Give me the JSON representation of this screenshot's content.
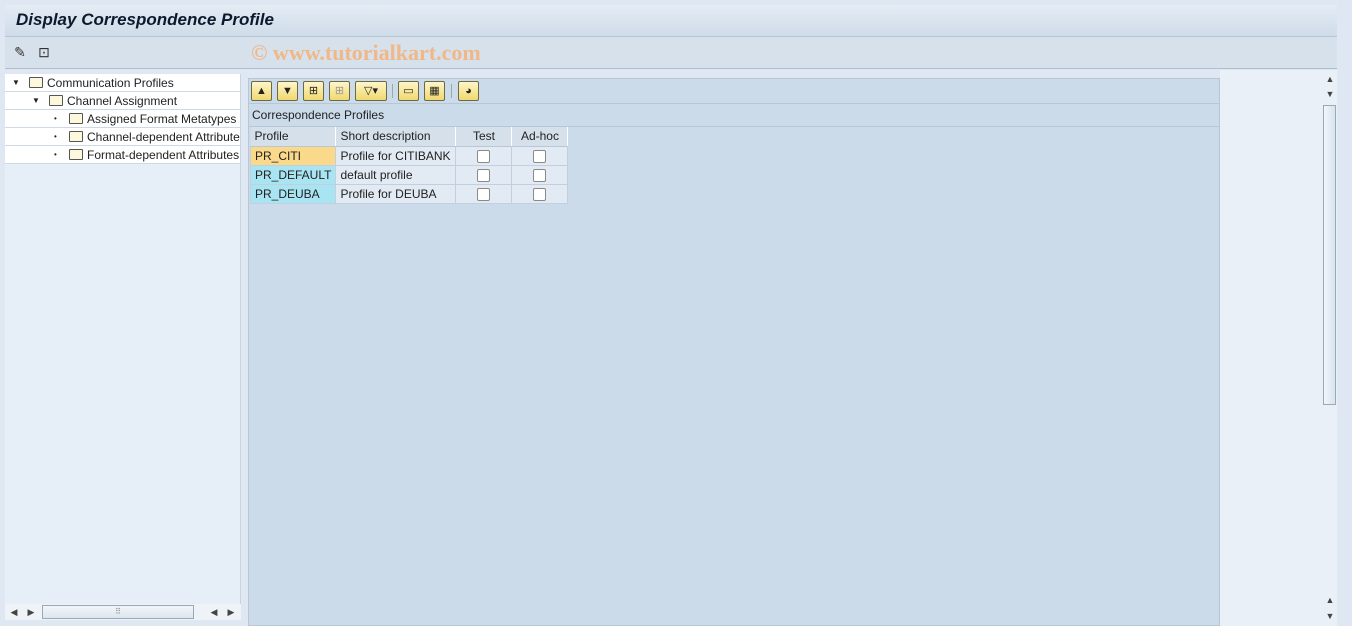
{
  "title": "Display Correspondence Profile",
  "watermark": "© www.tutorialkart.com",
  "toolbar": {
    "icons": [
      "display-change-icon",
      "other-object-icon"
    ]
  },
  "tree": {
    "items": [
      {
        "label": "Communication Profiles",
        "level": 0,
        "expanded": true
      },
      {
        "label": "Channel Assignment",
        "level": 1,
        "expanded": true
      },
      {
        "label": "Assigned Format Metatypes",
        "level": 2
      },
      {
        "label": "Channel-dependent Attributes",
        "level": 2
      },
      {
        "label": "Format-dependent Attributes",
        "level": 2
      }
    ]
  },
  "alv": {
    "toolbar_icons": [
      "details-icon",
      "filter-icon",
      "find-icon",
      "find-next-icon",
      "set-filter-icon",
      "print-icon",
      "layout-icon",
      "graphic-icon"
    ],
    "title": "Correspondence Profiles",
    "columns": [
      "Profile",
      "Short description",
      "Test",
      "Ad-hoc"
    ],
    "rows": [
      {
        "profile": "PR_CITI",
        "desc": "Profile for CITIBANK",
        "test": false,
        "adhoc": false
      },
      {
        "profile": "PR_DEFAULT",
        "desc": "default profile",
        "test": false,
        "adhoc": false
      },
      {
        "profile": "PR_DEUBA",
        "desc": "Profile for DEUBA",
        "test": false,
        "adhoc": false
      }
    ]
  }
}
